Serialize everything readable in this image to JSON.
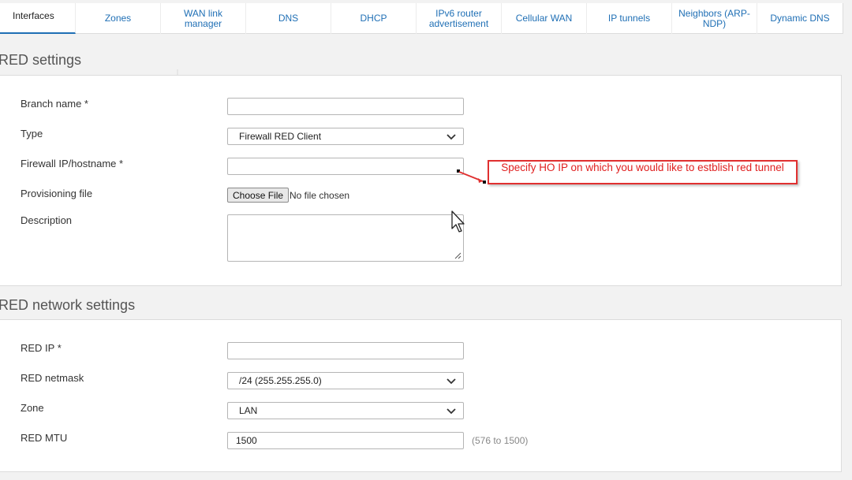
{
  "tabs": [
    {
      "label": "Interfaces"
    },
    {
      "label": "Zones"
    },
    {
      "label": "WAN link manager"
    },
    {
      "label": "DNS"
    },
    {
      "label": "DHCP"
    },
    {
      "label": "IPv6 router advertisement"
    },
    {
      "label": "Cellular WAN"
    },
    {
      "label": "IP tunnels"
    },
    {
      "label": "Neighbors (ARP-NDP)"
    },
    {
      "label": "Dynamic DNS"
    }
  ],
  "red_settings": {
    "title": "RED settings",
    "branch_name_label": "Branch name *",
    "branch_name_value": "",
    "type_label": "Type",
    "type_value": "Firewall RED Client",
    "firewall_ip_label": "Firewall IP/hostname *",
    "firewall_ip_value": "",
    "provisioning_label": "Provisioning file",
    "choose_file_label": "Choose File",
    "file_status": "No file chosen",
    "description_label": "Description"
  },
  "annotation": {
    "text": "Specify HO IP on which you would like to estblish red tunnel",
    "color": "#e02020"
  },
  "red_network": {
    "title": "RED network settings",
    "red_ip_label": "RED IP *",
    "red_ip_value": "",
    "netmask_label": "RED netmask",
    "netmask_value": "/24 (255.255.255.0)",
    "zone_label": "Zone",
    "zone_value": "LAN",
    "mtu_label": "RED MTU",
    "mtu_value": "1500",
    "mtu_hint": "(576 to 1500)"
  },
  "colors": {
    "accent": "#1f6fb5",
    "annotation_red": "#e03030"
  }
}
